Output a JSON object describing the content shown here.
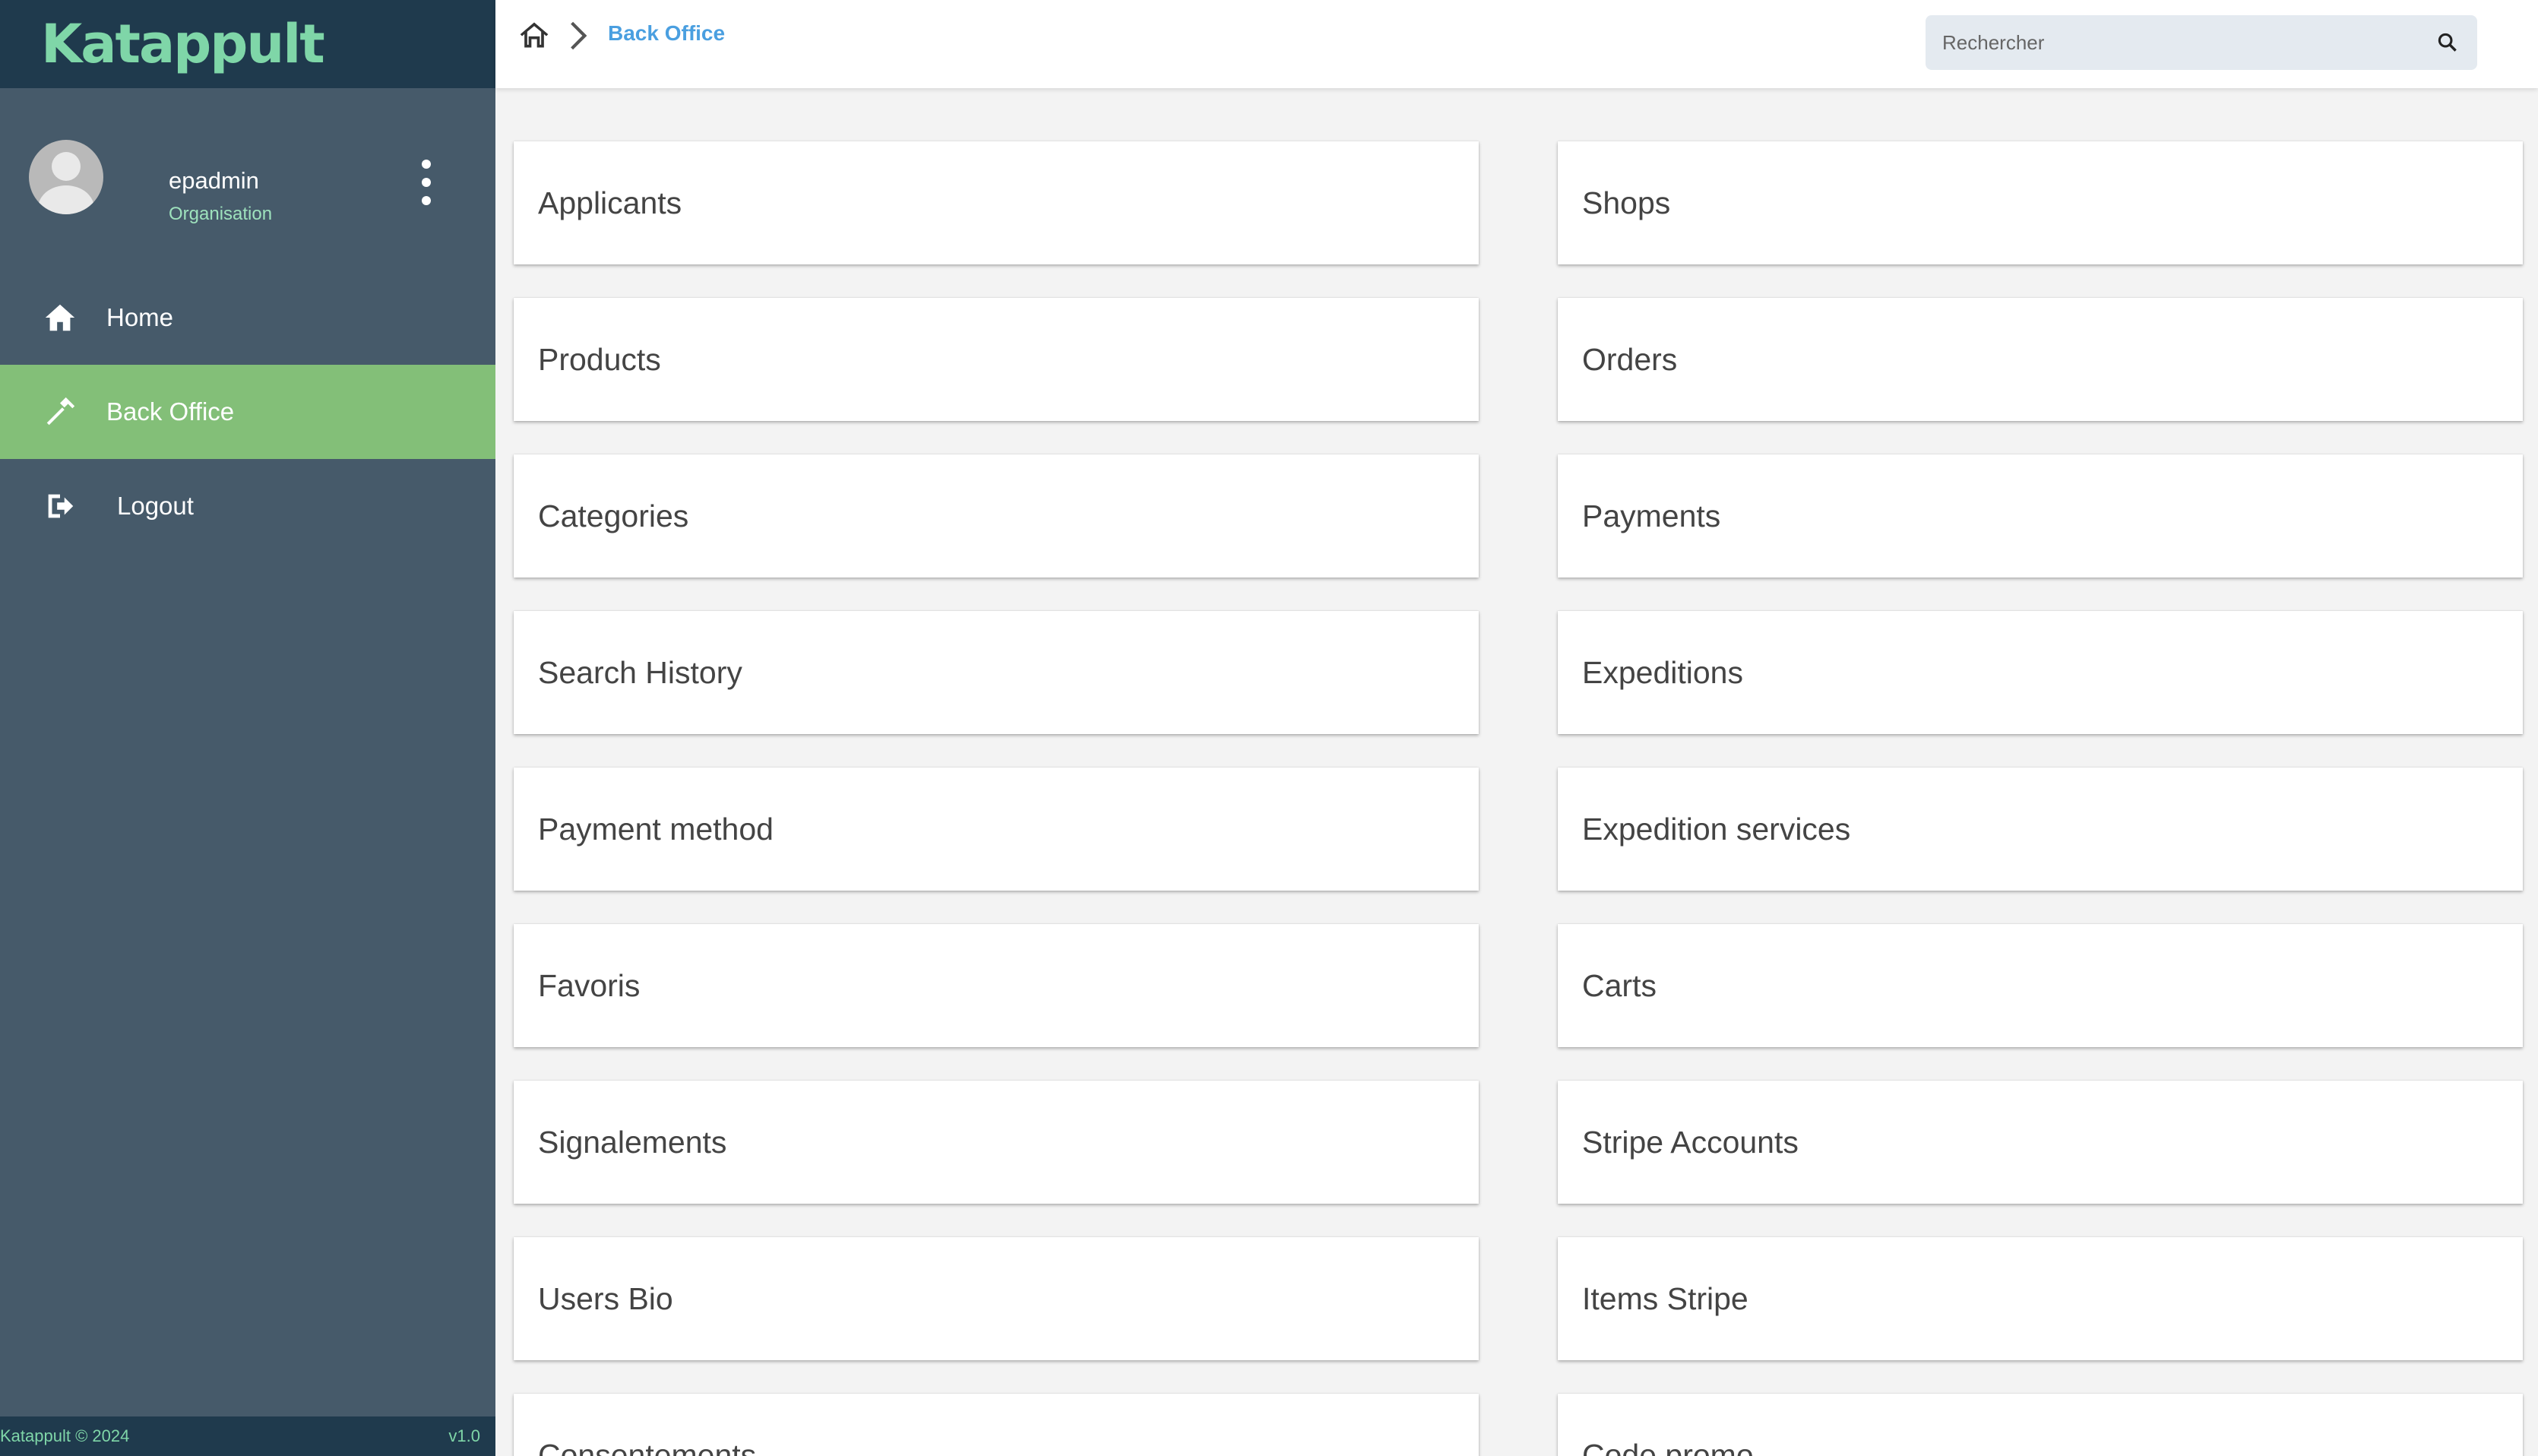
{
  "app": {
    "brand": "Katappult"
  },
  "sidebar": {
    "user": {
      "name": "epadmin",
      "role": "Organisation"
    },
    "items": [
      {
        "label": "Home",
        "icon": "home-icon",
        "active": false
      },
      {
        "label": "Back Office",
        "icon": "hammer-icon",
        "active": true
      },
      {
        "label": "Logout",
        "icon": "logout-icon",
        "active": false
      }
    ],
    "footer": {
      "copyright": "Katappult © 2024",
      "version": "v1.0"
    }
  },
  "topbar": {
    "breadcrumb_current": "Back Office",
    "search_placeholder": "Rechercher"
  },
  "cards": [
    "Applicants",
    "Shops",
    "Products",
    "Orders",
    "Categories",
    "Payments",
    "Search History",
    "Expeditions",
    "Payment method",
    "Expedition services",
    "Favoris",
    "Carts",
    "Signalements",
    "Stripe Accounts",
    "Users Bio",
    "Items Stripe",
    "Consentements",
    "Code promo"
  ],
  "colors": {
    "sidebar": "#465a6a",
    "brand_bar": "#1f3a4d",
    "accent_green": "#83bf78",
    "brand_text": "#7fd6a8",
    "link_blue": "#4a9fe0"
  }
}
